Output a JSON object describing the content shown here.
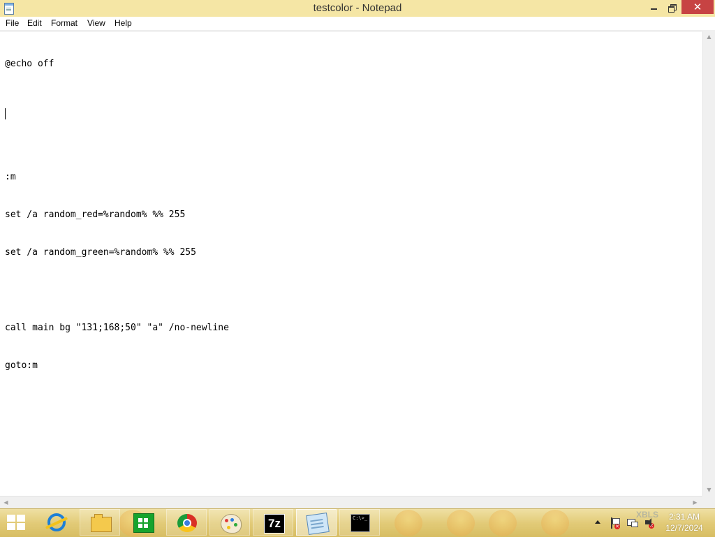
{
  "window": {
    "title": "testcolor - Notepad",
    "controls": {
      "close_glyph": "✕"
    }
  },
  "menu": [
    "File",
    "Edit",
    "Format",
    "View",
    "Help"
  ],
  "editor": {
    "lines": [
      "@echo off",
      "",
      "",
      ":m",
      "set /a random_red=%random% %% 255",
      "set /a random_green=%random% %% 255",
      "",
      "call main bg \"131;168;50\" \"a\" /no-newline",
      "goto:m"
    ]
  },
  "scrollbars": {
    "up_glyph": "▲",
    "down_glyph": "▼",
    "left_glyph": "◀",
    "right_glyph": "▶"
  },
  "taskbar": {
    "apps": [
      {
        "icon": "internet-explorer-icon"
      },
      {
        "icon": "file-explorer-icon"
      },
      {
        "icon": "store-icon"
      },
      {
        "icon": "chrome-icon"
      },
      {
        "icon": "paint-icon"
      },
      {
        "icon": "7zip-icon",
        "glyph": "7z"
      },
      {
        "icon": "notepad-icon"
      },
      {
        "icon": "command-prompt-icon",
        "glyph": "C:\\>_"
      }
    ],
    "tray": {
      "watermark": "XBLS",
      "time": "2:31 AM",
      "date": "12/7/2024"
    }
  },
  "colors": {
    "titlebar": "#f5e6a5",
    "close_button": "#c74343",
    "taskbar": "#e2cb78"
  }
}
